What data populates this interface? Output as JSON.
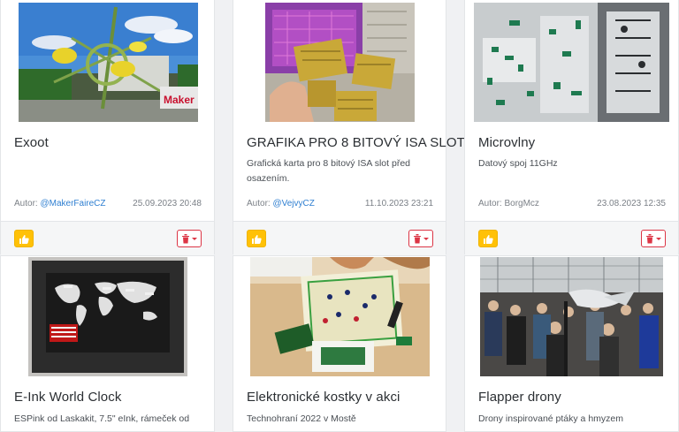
{
  "cards": [
    {
      "title": "Exoot",
      "description": "",
      "author_prefix": "Autor:",
      "author": "@MakerFaireCZ",
      "date": "25.09.2023 20:48",
      "image_text": "Maker"
    },
    {
      "title": "GRAFIKA PRO 8 BITOVÝ ISA SLOT",
      "description": "Grafická karta pro 8 bitový ISA slot před osazením.",
      "author_prefix": "Autor:",
      "author": "@VejvyCZ",
      "date": "11.10.2023 23:21"
    },
    {
      "title": "Microvlny",
      "description": "Datový spoj 11GHz",
      "author_prefix": "Autor:",
      "author": "BorgMcz",
      "date": "23.08.2023 12:35"
    },
    {
      "title": "E-Ink World Clock",
      "description": "ESPink od Laskakit, 7.5\" eInk, rámeček od"
    },
    {
      "title": "Elektronické kostky v akci",
      "description": "Technohraní 2022 v Mostě"
    },
    {
      "title": "Flapper drony",
      "description": "Drony inspirované ptáky a hmyzem"
    }
  ],
  "icons": {
    "like": "thumbs-up-icon",
    "delete": "trash-icon"
  },
  "colors": {
    "like_button": "#ffc107",
    "delete_border": "#dc3545",
    "link": "#2f7fd1"
  }
}
